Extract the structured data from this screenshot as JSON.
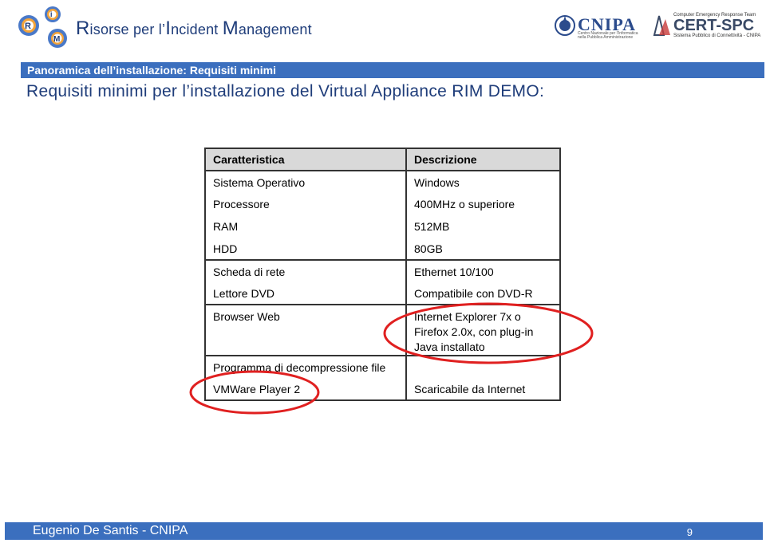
{
  "header": {
    "title_parts": [
      {
        "cap": "R",
        "rest": "isorse per l’"
      },
      {
        "cap": "I",
        "rest": "ncident "
      },
      {
        "cap": "M",
        "rest": "anagement"
      }
    ],
    "cnipa_logo": {
      "name": "CNIPA",
      "subtitle": "Centro Nazionale per l’Informatica nella Pubblica Amministrazione"
    },
    "cert_logo": {
      "top": "Computer Emergency Response Team",
      "name": "CERT-SPC",
      "subtitle": "Sistema Pubblico di Connettività - CNIPA"
    }
  },
  "section_bar": "Panoramica dell’installazione: Requisiti minimi",
  "slide_title": "Requisiti minimi per l’installazione del Virtual Appliance RIM DEMO:",
  "table": {
    "headers": [
      "Caratteristica",
      "Descrizione"
    ],
    "rows": [
      [
        "Sistema Operativo",
        "Windows"
      ],
      [
        "Processore",
        "400MHz o superiore"
      ],
      [
        "RAM",
        "512MB"
      ],
      [
        "HDD",
        "80GB"
      ],
      [
        "Scheda di rete",
        "Ethernet 10/100"
      ],
      [
        "Lettore DVD",
        "Compatibile con DVD-R"
      ],
      [
        "Browser Web",
        "Internet Explorer 7x o Firefox 2.0x, con plug-in Java installato"
      ],
      [
        "Programma di decompressione file",
        ""
      ],
      [
        "VMWare Player 2",
        "Scaricabile da Internet"
      ]
    ]
  },
  "highlight_color": "#e02020",
  "accent_color": "#3b6fbe",
  "footer": {
    "author": "Eugenio De Santis - CNIPA",
    "page": "9"
  }
}
